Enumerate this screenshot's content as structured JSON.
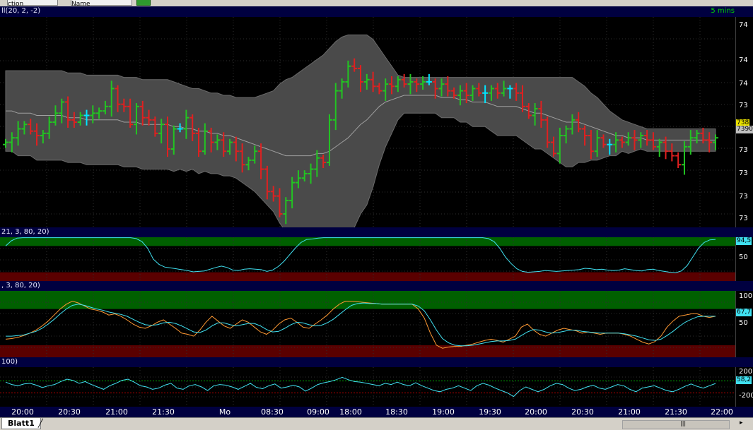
{
  "toolbar": {
    "field1": "ction",
    "field2": "Name"
  },
  "panels": {
    "price": {
      "header": "ll(20, 2, -2)",
      "timeframe": "5 mins",
      "axis_labels": [
        "74",
        "74",
        "74",
        "73",
        "73",
        "73",
        "73",
        "73",
        "73"
      ],
      "last_tags": [
        "738",
        "7390"
      ]
    },
    "stoch1": {
      "header": "21, 3, 80, 20)",
      "axis_labels": [
        "50"
      ],
      "last_tag": "94,5"
    },
    "stoch2": {
      "header": ", 3, 80, 20)",
      "axis_labels": [
        "100",
        "50"
      ],
      "last_tag": "67,7"
    },
    "cci": {
      "header": "100)",
      "axis_labels": [
        "200",
        "-200"
      ],
      "last_tag": "58,2"
    }
  },
  "time_axis": [
    "20:00",
    "20:30",
    "21:00",
    "21:30",
    "Mo",
    "08:30",
    "09:00",
    "18:00",
    "18:30",
    "19:00",
    "19:30",
    "20:00",
    "20:30",
    "21:00",
    "21:30",
    "22:00"
  ],
  "tabs": {
    "sheet": "Blatt1"
  },
  "colors": {
    "up_bar": "#22c422",
    "down_bar": "#e02020",
    "doji_bar": "#00e5ff",
    "band_fill": "#4a4a4a",
    "header_bg": "#000040",
    "ob_zone": "#006000",
    "os_zone": "#5a0000",
    "stoch_k": "#ff9933",
    "stoch_d": "#40e0f0",
    "cci_line": "#40e0f0"
  },
  "chart_data": [
    {
      "type": "ohlc",
      "title": "",
      "bars_close": [
        7392,
        7394,
        7398,
        7400,
        7397,
        7395,
        7396,
        7401,
        7405,
        7410,
        7402,
        7401,
        7404,
        7404,
        7405,
        7406,
        7408,
        7416,
        7409,
        7408,
        7400,
        7408,
        7403,
        7402,
        7396,
        7400,
        7389,
        7398,
        7398,
        7403,
        7396,
        7388,
        7397,
        7392,
        7393,
        7388,
        7392,
        7388,
        7382,
        7384,
        7388,
        7380,
        7370,
        7368,
        7360,
        7366,
        7374,
        7376,
        7378,
        7380,
        7385,
        7383,
        7402,
        7415,
        7419,
        7426,
        7425,
        7419,
        7420,
        7417,
        7415,
        7418,
        7417,
        7420,
        7418,
        7419,
        7418,
        7419,
        7419,
        7416,
        7418,
        7415,
        7413,
        7415,
        7413,
        7416,
        7414,
        7414,
        7416,
        7414,
        7416,
        7416,
        7414,
        7408,
        7404,
        7407,
        7402,
        7392,
        7387,
        7395,
        7398,
        7402,
        7398,
        7395,
        7388,
        7394,
        7391,
        7391,
        7393,
        7392,
        7394,
        7393,
        7395,
        7393,
        7390,
        7392,
        7388,
        7386,
        7382,
        7390,
        7394,
        7396,
        7393,
        7392,
        7394
      ],
      "bands": {
        "upper": [
          7424,
          7424,
          7424,
          7424,
          7424,
          7424,
          7424,
          7424,
          7424,
          7424,
          7423,
          7423,
          7423,
          7422,
          7422,
          7422,
          7422,
          7422,
          7422,
          7421,
          7421,
          7421,
          7420,
          7420,
          7420,
          7420,
          7420,
          7419,
          7418,
          7417,
          7416,
          7416,
          7415,
          7414,
          7414,
          7413,
          7413,
          7412,
          7412,
          7412,
          7412,
          7413,
          7414,
          7415,
          7418,
          7420,
          7421,
          7423,
          7425,
          7427,
          7429,
          7431,
          7434,
          7437,
          7439,
          7440,
          7440,
          7440,
          7440,
          7438,
          7434,
          7430,
          7426,
          7422,
          7421,
          7421,
          7421,
          7421,
          7421,
          7421,
          7421,
          7421,
          7421,
          7421,
          7421,
          7421,
          7421,
          7421,
          7421,
          7421,
          7421,
          7421,
          7421,
          7421,
          7421,
          7421,
          7421,
          7421,
          7421,
          7421,
          7421,
          7421,
          7419,
          7417,
          7414,
          7412,
          7409,
          7406,
          7404,
          7402,
          7401,
          7400,
          7399,
          7398,
          7398,
          7398,
          7398,
          7398,
          7398,
          7398,
          7398,
          7398,
          7398,
          7398,
          7398
        ],
        "middle": [
          7406,
          7406,
          7405,
          7405,
          7405,
          7404,
          7404,
          7404,
          7404,
          7404,
          7403,
          7403,
          7403,
          7402,
          7402,
          7402,
          7402,
          7402,
          7402,
          7401,
          7401,
          7401,
          7400,
          7400,
          7400,
          7400,
          7400,
          7399,
          7399,
          7398,
          7398,
          7397,
          7397,
          7396,
          7396,
          7395,
          7395,
          7394,
          7393,
          7392,
          7391,
          7390,
          7389,
          7388,
          7387,
          7386,
          7386,
          7386,
          7386,
          7386,
          7387,
          7387,
          7388,
          7390,
          7392,
          7394,
          7397,
          7400,
          7402,
          7405,
          7408,
          7410,
          7411,
          7412,
          7413,
          7413,
          7413,
          7413,
          7413,
          7413,
          7412,
          7412,
          7412,
          7411,
          7411,
          7410,
          7410,
          7410,
          7409,
          7408,
          7408,
          7408,
          7408,
          7407,
          7406,
          7405,
          7405,
          7404,
          7403,
          7402,
          7401,
          7401,
          7401,
          7400,
          7399,
          7398,
          7397,
          7396,
          7395,
          7395,
          7394,
          7394,
          7394,
          7393,
          7393,
          7393,
          7393,
          7393,
          7393,
          7393,
          7393,
          7393,
          7393,
          7393,
          7393
        ],
        "lower": [
          7388,
          7388,
          7386,
          7386,
          7386,
          7384,
          7384,
          7384,
          7384,
          7384,
          7383,
          7383,
          7383,
          7382,
          7382,
          7382,
          7382,
          7382,
          7382,
          7381,
          7381,
          7381,
          7380,
          7380,
          7380,
          7380,
          7380,
          7379,
          7380,
          7379,
          7380,
          7378,
          7379,
          7378,
          7378,
          7377,
          7377,
          7376,
          7374,
          7372,
          7370,
          7367,
          7364,
          7361,
          7356,
          7352,
          7351,
          7349,
          7347,
          7345,
          7345,
          7343,
          7342,
          7343,
          7345,
          7348,
          7354,
          7360,
          7364,
          7372,
          7382,
          7390,
          7396,
          7402,
          7405,
          7405,
          7405,
          7405,
          7405,
          7405,
          7403,
          7403,
          7403,
          7401,
          7401,
          7399,
          7399,
          7399,
          7397,
          7395,
          7395,
          7395,
          7395,
          7393,
          7391,
          7389,
          7389,
          7387,
          7385,
          7383,
          7381,
          7381,
          7383,
          7383,
          7384,
          7384,
          7385,
          7386,
          7386,
          7388,
          7387,
          7388,
          7389,
          7388,
          7388,
          7388,
          7388,
          7388,
          7388,
          7388,
          7388,
          7388,
          7388,
          7388,
          7388
        ]
      },
      "ylim": [
        7354,
        7448
      ]
    },
    {
      "type": "line",
      "series": [
        {
          "values": [
            80,
            92,
            98,
            99,
            99,
            99,
            99,
            99,
            99,
            99,
            99,
            99,
            99,
            99,
            99,
            99,
            99,
            99,
            99,
            99,
            99,
            99,
            99,
            97,
            90,
            75,
            50,
            38,
            32,
            30,
            28,
            26,
            24,
            21,
            22,
            23,
            27,
            31,
            34,
            31,
            25,
            24,
            27,
            28,
            27,
            26,
            22,
            25,
            33,
            45,
            60,
            75,
            88,
            95,
            96,
            98,
            99,
            99,
            99,
            99,
            99,
            99,
            99,
            99,
            99,
            99,
            99,
            99,
            99,
            99,
            99,
            99,
            99,
            99,
            99,
            99,
            99,
            99,
            99,
            99,
            99,
            99,
            99,
            99,
            99,
            97,
            90,
            75,
            55,
            40,
            28,
            22,
            20,
            21,
            22,
            24,
            23,
            22,
            23,
            24,
            25,
            26,
            29,
            28,
            26,
            27,
            25,
            24,
            25,
            28,
            26,
            24,
            23,
            26,
            27,
            24,
            22,
            20,
            19,
            23,
            35,
            55,
            75,
            88,
            94,
            95
          ]
        }
      ],
      "ylim": [
        0,
        100
      ]
    },
    {
      "type": "line",
      "series": [
        {
          "values": [
            30,
            31,
            33,
            36,
            40,
            45,
            52,
            60,
            70,
            80,
            88,
            93,
            90,
            85,
            80,
            78,
            75,
            70,
            72,
            68,
            62,
            55,
            50,
            48,
            52,
            58,
            62,
            55,
            48,
            40,
            38,
            35,
            45,
            58,
            68,
            60,
            52,
            48,
            55,
            62,
            58,
            50,
            42,
            38,
            45,
            55,
            62,
            65,
            58,
            50,
            48,
            55,
            62,
            70,
            80,
            88,
            93,
            93,
            92,
            91,
            90,
            89,
            88,
            88,
            88,
            88,
            88,
            88,
            80,
            65,
            40,
            20,
            15,
            17,
            18,
            18,
            20,
            22,
            25,
            28,
            30,
            28,
            25,
            30,
            35,
            50,
            55,
            45,
            38,
            35,
            40,
            45,
            48,
            46,
            44,
            40,
            42,
            40,
            38,
            40,
            40,
            40,
            38,
            35,
            30,
            25,
            22,
            26,
            35,
            50,
            60,
            68,
            70,
            72,
            72,
            68,
            66,
            68
          ]
        },
        {
          "values": [
            35,
            35,
            36,
            37,
            40,
            43,
            48,
            55,
            63,
            72,
            80,
            86,
            88,
            86,
            83,
            80,
            78,
            75,
            73,
            71,
            68,
            63,
            58,
            54,
            53,
            54,
            57,
            58,
            56,
            52,
            47,
            42,
            41,
            45,
            52,
            57,
            57,
            54,
            52,
            54,
            56,
            56,
            52,
            46,
            42,
            43,
            48,
            54,
            58,
            57,
            54,
            52,
            53,
            57,
            63,
            71,
            79,
            86,
            89,
            90,
            89,
            89,
            88,
            88,
            88,
            88,
            88,
            88,
            85,
            77,
            62,
            45,
            31,
            24,
            20,
            19,
            19,
            20,
            22,
            24,
            26,
            27,
            27,
            28,
            30,
            36,
            42,
            46,
            45,
            42,
            40,
            41,
            43,
            45,
            45,
            43,
            42,
            41,
            40,
            40,
            40,
            40,
            39,
            37,
            35,
            32,
            29,
            28,
            30,
            36,
            43,
            51,
            58,
            63,
            67,
            68,
            68,
            68
          ]
        }
      ],
      "ylim": [
        0,
        110
      ]
    },
    {
      "type": "line",
      "series": [
        {
          "values": [
            80,
            40,
            20,
            50,
            60,
            30,
            -10,
            20,
            40,
            90,
            130,
            110,
            60,
            90,
            40,
            0,
            -40,
            20,
            60,
            110,
            130,
            80,
            20,
            0,
            -40,
            -20,
            30,
            60,
            -20,
            -40,
            20,
            40,
            0,
            -60,
            20,
            40,
            30,
            0,
            -40,
            10,
            60,
            -10,
            -30,
            20,
            50,
            -20,
            0,
            30,
            0,
            -70,
            -20,
            40,
            70,
            90,
            120,
            160,
            120,
            90,
            80,
            60,
            40,
            20,
            60,
            40,
            80,
            40,
            20,
            70,
            20,
            -20,
            -60,
            -80,
            -40,
            -20,
            20,
            -20,
            -60,
            20,
            60,
            30,
            -20,
            -60,
            -100,
            -160,
            -60,
            0,
            -40,
            -80,
            -40,
            20,
            60,
            40,
            -20,
            -60,
            -40,
            0,
            30,
            -20,
            -40,
            0,
            40,
            20,
            -40,
            -80,
            -20,
            0,
            20,
            -20,
            -60,
            -80,
            -40,
            10,
            50,
            10,
            -20,
            20,
            58
          ]
        }
      ],
      "ylim": [
        -330,
        330
      ]
    }
  ]
}
